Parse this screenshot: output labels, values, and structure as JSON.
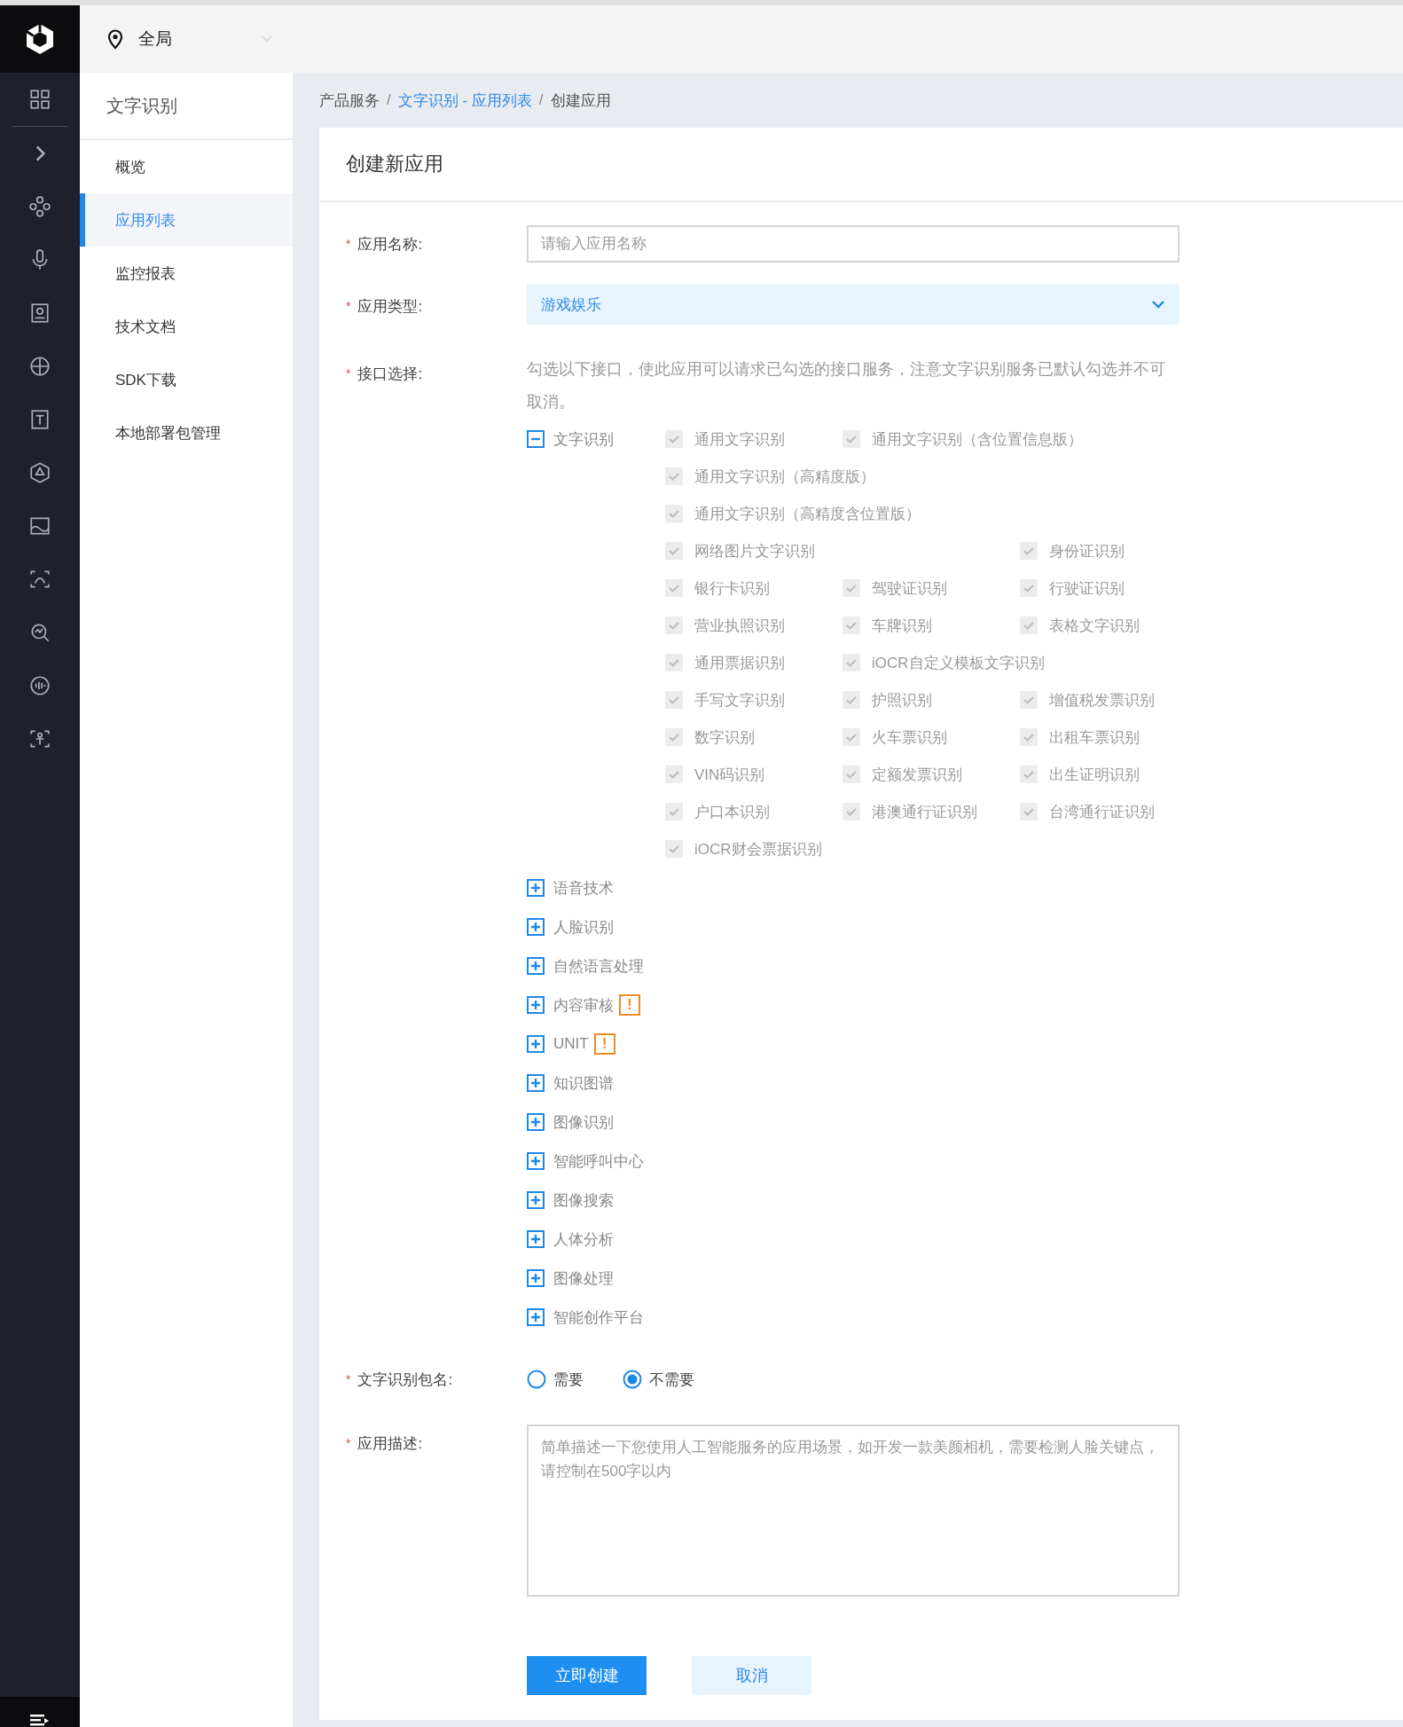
{
  "top_bar": {
    "region": "全局"
  },
  "side_nav": {
    "title": "文字识别",
    "items": [
      {
        "label": "概览",
        "selected": false
      },
      {
        "label": "应用列表",
        "selected": true
      },
      {
        "label": "监控报表",
        "selected": false
      },
      {
        "label": "技术文档",
        "selected": false
      },
      {
        "label": "SDK下载",
        "selected": false
      },
      {
        "label": "本地部署包管理",
        "selected": false
      }
    ]
  },
  "breadcrumb": [
    {
      "label": "产品服务",
      "kind": "text"
    },
    {
      "label": "/",
      "kind": "separator"
    },
    {
      "label": "文字识别 - 应用列表",
      "kind": "link"
    },
    {
      "label": "/",
      "kind": "separator"
    },
    {
      "label": "创建应用",
      "kind": "text"
    }
  ],
  "form": {
    "title": "创建新应用",
    "name_field": {
      "label": "应用名称:",
      "required_mark": "*",
      "placeholder": "请输入应用名称"
    },
    "type_field": {
      "label": "应用类型:",
      "required_mark": "*",
      "value": "游戏娱乐"
    },
    "interfaces": {
      "label": "接口选择:",
      "required_mark": "*",
      "hint": "勾选以下接口，使此应用可以请求已勾选的接口服务，注意文字识别服务已默认勾选并不可取消。",
      "groups": [
        {
          "label": "文字识别",
          "expanded": true,
          "items": [
            {
              "label": "通用文字识别",
              "kind": "normal",
              "checked": true,
              "disabled": true
            },
            {
              "label": "通用文字识别（含位置信息版）",
              "kind": "wide",
              "checked": true,
              "disabled": true
            },
            {
              "label": "通用文字识别（高精度版）",
              "kind": "wide",
              "checked": true,
              "disabled": true
            },
            {
              "label": "通用文字识别（高精度含位置版）",
              "kind": "wide",
              "checked": true,
              "disabled": true
            },
            {
              "label": "网络图片文字识别",
              "kind": "wide",
              "checked": true,
              "disabled": true
            },
            {
              "label": "身份证识别",
              "kind": "normal",
              "checked": true,
              "disabled": true
            },
            {
              "label": "银行卡识别",
              "kind": "normal",
              "checked": true,
              "disabled": true
            },
            {
              "label": "驾驶证识别",
              "kind": "normal",
              "checked": true,
              "disabled": true
            },
            {
              "label": "行驶证识别",
              "kind": "normal",
              "checked": true,
              "disabled": true
            },
            {
              "label": "营业执照识别",
              "kind": "normal",
              "checked": true,
              "disabled": true
            },
            {
              "label": "车牌识别",
              "kind": "normal",
              "checked": true,
              "disabled": true
            },
            {
              "label": "表格文字识别",
              "kind": "normal",
              "checked": true,
              "disabled": true
            },
            {
              "label": "通用票据识别",
              "kind": "normal",
              "checked": true,
              "disabled": true
            },
            {
              "label": "iOCR自定义模板文字识别",
              "kind": "wide",
              "checked": true,
              "disabled": true
            },
            {
              "label": "手写文字识别",
              "kind": "normal",
              "checked": true,
              "disabled": true
            },
            {
              "label": "护照识别",
              "kind": "normal",
              "checked": true,
              "disabled": true
            },
            {
              "label": "增值税发票识别",
              "kind": "normal",
              "checked": true,
              "disabled": true
            },
            {
              "label": "数字识别",
              "kind": "normal",
              "checked": true,
              "disabled": true
            },
            {
              "label": "火车票识别",
              "kind": "normal",
              "checked": true,
              "disabled": true
            },
            {
              "label": "出租车票识别",
              "kind": "normal",
              "checked": true,
              "disabled": true
            },
            {
              "label": "VIN码识别",
              "kind": "normal",
              "checked": true,
              "disabled": true
            },
            {
              "label": "定额发票识别",
              "kind": "normal",
              "checked": true,
              "disabled": true
            },
            {
              "label": "出生证明识别",
              "kind": "normal",
              "checked": true,
              "disabled": true
            },
            {
              "label": "户口本识别",
              "kind": "normal",
              "checked": true,
              "disabled": true
            },
            {
              "label": "港澳通行证识别",
              "kind": "normal",
              "checked": true,
              "disabled": true
            },
            {
              "label": "台湾通行证识别",
              "kind": "normal",
              "checked": true,
              "disabled": true
            },
            {
              "label": "iOCR财会票据识别",
              "kind": "wide",
              "checked": true,
              "disabled": true
            }
          ]
        },
        {
          "label": "语音技术",
          "expanded": false
        },
        {
          "label": "人脸识别",
          "expanded": false
        },
        {
          "label": "自然语言处理",
          "expanded": false
        },
        {
          "label": "内容审核",
          "expanded": false,
          "badge": "!"
        },
        {
          "label": "UNIT",
          "expanded": false,
          "badge": "!"
        },
        {
          "label": "知识图谱",
          "expanded": false
        },
        {
          "label": "图像识别",
          "expanded": false
        },
        {
          "label": "智能呼叫中心",
          "expanded": false
        },
        {
          "label": "图像搜索",
          "expanded": false
        },
        {
          "label": "人体分析",
          "expanded": false
        },
        {
          "label": "图像处理",
          "expanded": false
        },
        {
          "label": "智能创作平台",
          "expanded": false
        }
      ]
    },
    "package_field": {
      "label": "文字识别包名:",
      "required_mark": "*",
      "options": [
        {
          "label": "需要",
          "selected": false
        },
        {
          "label": "不需要",
          "selected": true
        }
      ]
    },
    "description_field": {
      "label": "应用描述:",
      "required_mark": "*",
      "placeholder": "简单描述一下您使用人工智能服务的应用场景，如开发一款美颜相机，需要检测人脸关键点，请控制在500字以内"
    },
    "buttons": [
      {
        "label": "立即创建",
        "kind": "primary"
      },
      {
        "label": "取消",
        "kind": "secondary"
      }
    ]
  }
}
